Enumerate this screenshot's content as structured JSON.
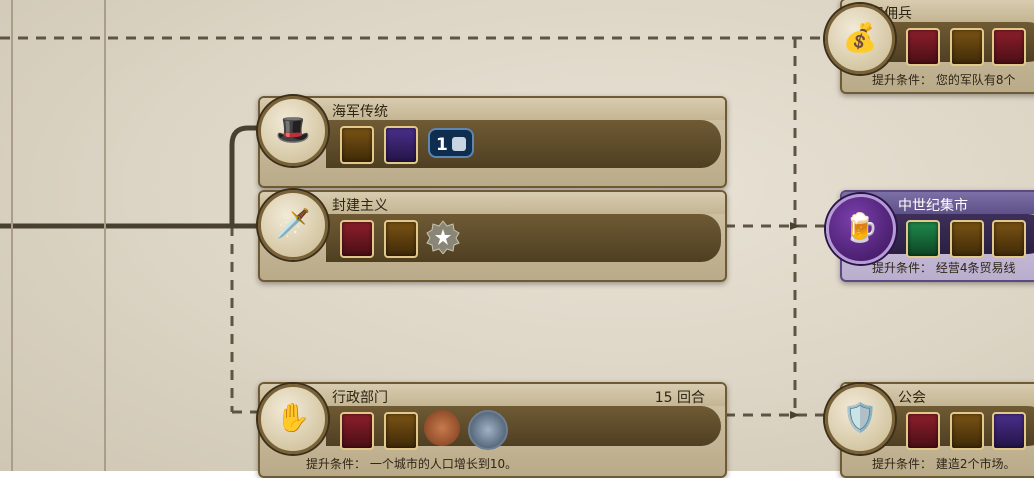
{
  "cards": {
    "mercenaries": {
      "title": "雇佣兵",
      "requirement": "提升条件： 您的军队有8个"
    },
    "naval_tradition": {
      "title": "海军传统",
      "badge_value": "1"
    },
    "feudalism": {
      "title": "封建主义"
    },
    "medieval_faires": {
      "title": "中世纪集市",
      "requirement": "提升条件： 经营4条贸易线"
    },
    "civil_service": {
      "title": "行政部门",
      "turns": "15 回合",
      "requirement": "提升条件： 一个城市的人口增长到10。"
    },
    "guilds": {
      "title": "公会",
      "requirement": "提升条件： 建造2个市场。"
    }
  },
  "colors": {
    "military": "#8c1f2b",
    "economic": "#7a5314",
    "diplomatic": "#4b2f8c",
    "wildcard": "#1f8a4c",
    "card_border": "#6e5b36",
    "purple_card": "#5e5088"
  },
  "icons": {
    "mercenaries": "sack-helmet-icon",
    "naval_tradition": "captain-hat-icon",
    "feudalism": "gold-and-sword-icon",
    "medieval_faires": "mug-and-meat-icon",
    "civil_service": "hand-icon",
    "guilds": "guild-shield-icon"
  }
}
